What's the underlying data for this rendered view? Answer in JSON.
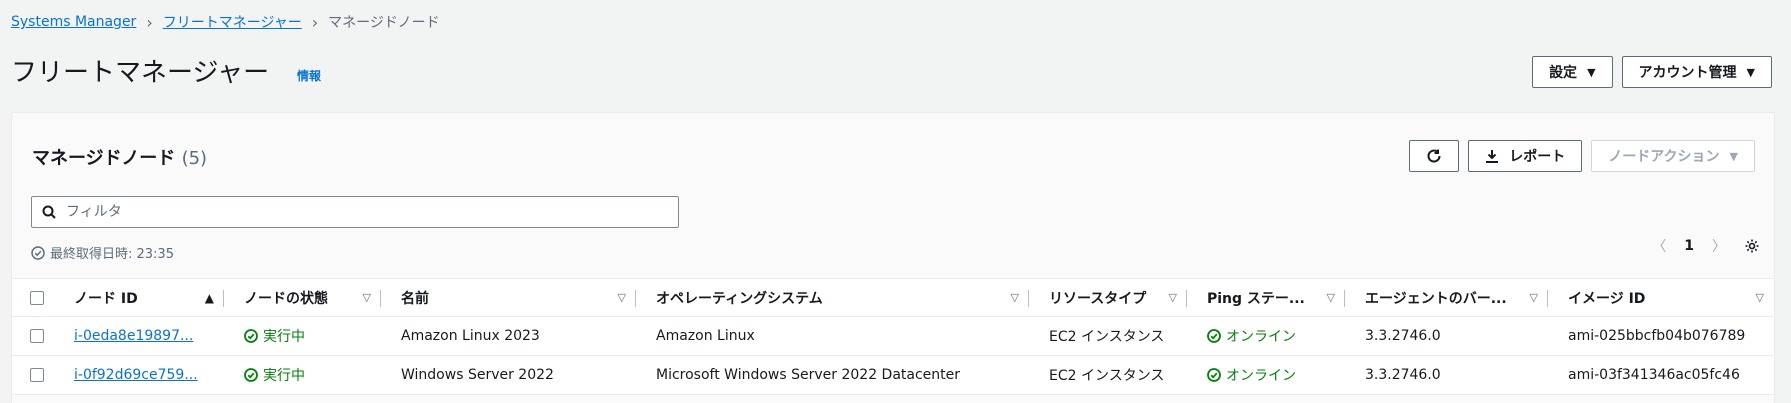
{
  "breadcrumb": {
    "root": "Systems Manager",
    "parent": "フリートマネージャー",
    "current": "マネージドノード"
  },
  "header": {
    "title": "フリートマネージャー",
    "info_label": "情報",
    "settings_label": "設定",
    "account_label": "アカウント管理"
  },
  "panel": {
    "title": "マネージドノード",
    "count": "(5)",
    "report_label": "レポート",
    "node_action_label": "ノードアクション",
    "filter_placeholder": "フィルタ",
    "timestamp": "最終取得日時: 23:35",
    "current_page": "1"
  },
  "table": {
    "columns": {
      "node_id": "ノード ID",
      "state": "ノードの状態",
      "name": "名前",
      "os": "オペレーティングシステム",
      "resource_type": "リソースタイプ",
      "ping": "Ping ステー...",
      "agent": "エージェントのバー...",
      "image_id": "イメージ ID"
    },
    "rows": [
      {
        "node_id": "i-0eda8e19897...",
        "state": "実行中",
        "name": "Amazon Linux 2023",
        "os": "Amazon Linux",
        "resource_type": "EC2 インスタンス",
        "ping": "オンライン",
        "agent": "3.3.2746.0",
        "image_id": "ami-025bbcfb04b076789"
      },
      {
        "node_id": "i-0f92d69ce759...",
        "state": "実行中",
        "name": "Windows Server 2022",
        "os": "Microsoft Windows Server 2022 Datacenter",
        "resource_type": "EC2 インスタンス",
        "ping": "オンライン",
        "agent": "3.3.2746.0",
        "image_id": "ami-03f341346ac05fc46"
      }
    ]
  },
  "colors": {
    "link": "#0972d3",
    "success": "#037f0c",
    "text": "#16191f",
    "muted": "#5f6b7a"
  }
}
